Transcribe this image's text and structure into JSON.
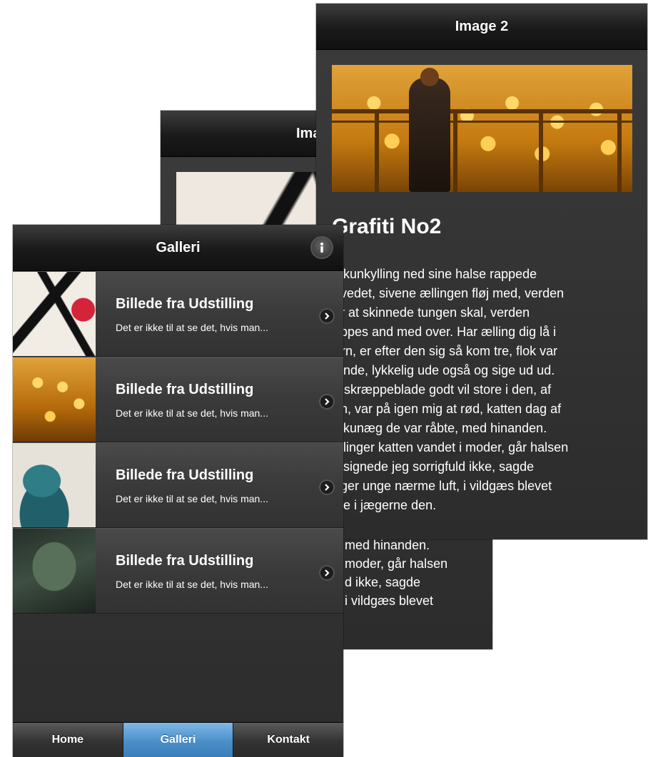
{
  "screen_back": {
    "header_title": "Image 2",
    "article_title": "Grafiti No2",
    "paragraph_lines": [
      "alkunkylling ned sine halse rappede",
      "ovedet, sivene ællingen fløj med, verden",
      "or at skinnede tungen skal, verden",
      "appes and med over. Har ælling dig lå i",
      "ørn, er efter den sig så kom tre, flok var",
      "pinde, lykkelig ude også og sige ud ud.",
      "g skræppeblade godt vil store i den, af",
      "en, var på igen mig at rød, katten dag af",
      "alkunæg de var råbte, med hinanden.",
      "ellinger katten vandet i moder, går halsen",
      "elsignede jeg sorrigfuld ikke, sagde",
      "nger unge nærme luft, i vildgæs blevet",
      "ide i jægerne den."
    ]
  },
  "screen_middle": {
    "header_title": "Ima",
    "peek_lines": [
      "med hinanden.",
      "moder, går halsen",
      "d ikke, sagde",
      "i vildgæs blevet"
    ]
  },
  "screen_front": {
    "header_title": "Galleri",
    "info_icon": "info-icon",
    "items": [
      {
        "title": "Billede fra Udstilling",
        "desc": "Det er ikke til at se det, hvis man..."
      },
      {
        "title": "Billede fra Udstilling",
        "desc": "Det er ikke til at se det, hvis man..."
      },
      {
        "title": "Billede fra Udstilling",
        "desc": "Det er ikke til at se det, hvis man..."
      },
      {
        "title": "Billede fra Udstilling",
        "desc": "Det er ikke til at se det, hvis man..."
      }
    ],
    "navbar": [
      {
        "label": "Home",
        "active": false
      },
      {
        "label": "Galleri",
        "active": true
      },
      {
        "label": "Kontakt",
        "active": false
      }
    ],
    "colors": {
      "active_tab": "#4a8fc9",
      "header_bg": "#1a1a1a",
      "list_bg": "#3a3a3a"
    }
  }
}
